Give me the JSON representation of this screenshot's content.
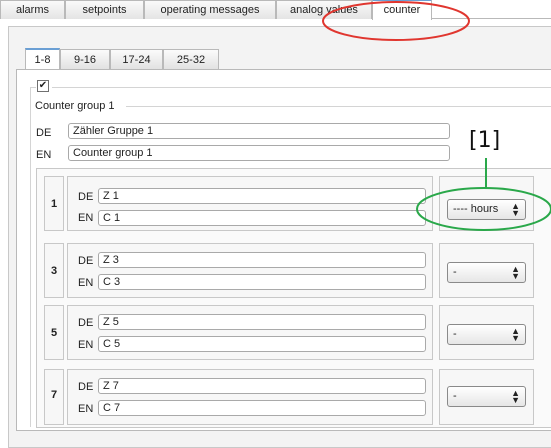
{
  "tabs": [
    "alarms",
    "setpoints",
    "operating messages",
    "analog values",
    "counter"
  ],
  "active_tab": "counter",
  "subtabs": [
    "1-8",
    "9-16",
    "17-24",
    "25-32"
  ],
  "active_subtab": "1-8",
  "checkbox_mark": "✔",
  "group": {
    "title": "Counter group 1",
    "de_label": "DE",
    "de_value": "Zähler Gruppe 1",
    "en_label": "EN",
    "en_value": "Counter group 1"
  },
  "annotation": {
    "text": "[1]",
    "color": "#2aa84a",
    "highlight_color": "#e0362f"
  },
  "counters": [
    {
      "number": "1",
      "de_label": "DE",
      "de_value": "Z 1",
      "en_label": "EN",
      "en_value": "C 1",
      "unit": "---- hours"
    },
    {
      "number": "3",
      "de_label": "DE",
      "de_value": "Z 3",
      "en_label": "EN",
      "en_value": "C 3",
      "unit": "-"
    },
    {
      "number": "5",
      "de_label": "DE",
      "de_value": "Z 5",
      "en_label": "EN",
      "en_value": "C 5",
      "unit": "-"
    },
    {
      "number": "7",
      "de_label": "DE",
      "de_value": "Z 7",
      "en_label": "EN",
      "en_value": "C 7",
      "unit": "-"
    }
  ],
  "select_arrow": "▲▼"
}
